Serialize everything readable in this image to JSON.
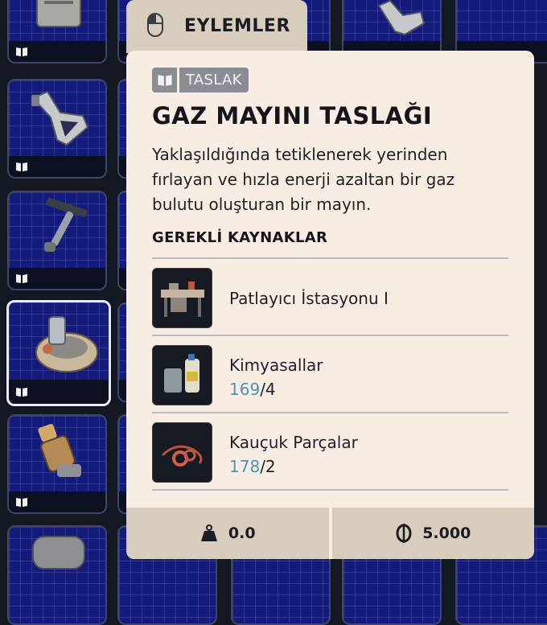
{
  "actions": {
    "label": "EYLEMLER",
    "icon": "mouse-icon"
  },
  "item": {
    "tag": {
      "icon": "book-icon",
      "label": "TASLAK"
    },
    "title": "GAZ MAYINI TASLAĞI",
    "description": "Yaklaşıldığında tetiklenerek yerinden fırlayan ve hızla enerji azaltan bir gaz bulutu oluşturan bir mayın.",
    "requirements_label": "GEREKLİ KAYNAKLAR",
    "requirements": [
      {
        "name": "Patlayıcı İstasyonu I",
        "icon": "workbench-icon"
      },
      {
        "name": "Kimyasallar",
        "have": "169",
        "need": "/4",
        "icon": "chemicals-icon"
      },
      {
        "name": "Kauçuk Parçalar",
        "have": "178",
        "need": "/2",
        "icon": "rubber-parts-icon"
      }
    ],
    "weight": {
      "icon": "weight-icon",
      "value": "0.0"
    },
    "price": {
      "icon": "coin-icon",
      "value": "5.000"
    }
  },
  "inventory": {
    "slots": [
      {
        "icon": "book-icon",
        "item": "blueprint-item",
        "selected": false
      },
      {
        "icon": "book-icon",
        "item": "blueprint-item",
        "selected": false
      },
      {
        "icon": "book-icon",
        "item": "blueprint-item",
        "selected": false
      },
      {
        "icon": "book-icon",
        "item": "gas-mine-blueprint",
        "selected": true
      },
      {
        "icon": "book-icon",
        "item": "blueprint-item",
        "selected": false
      },
      {
        "icon": "book-icon",
        "item": "blueprint-item",
        "selected": false
      }
    ]
  },
  "colors": {
    "accent_blue": "#4f92b3",
    "panel_bg": "#f8ede2",
    "tab_bg": "#d8ccbd",
    "slot_bg": "#141b7a"
  }
}
